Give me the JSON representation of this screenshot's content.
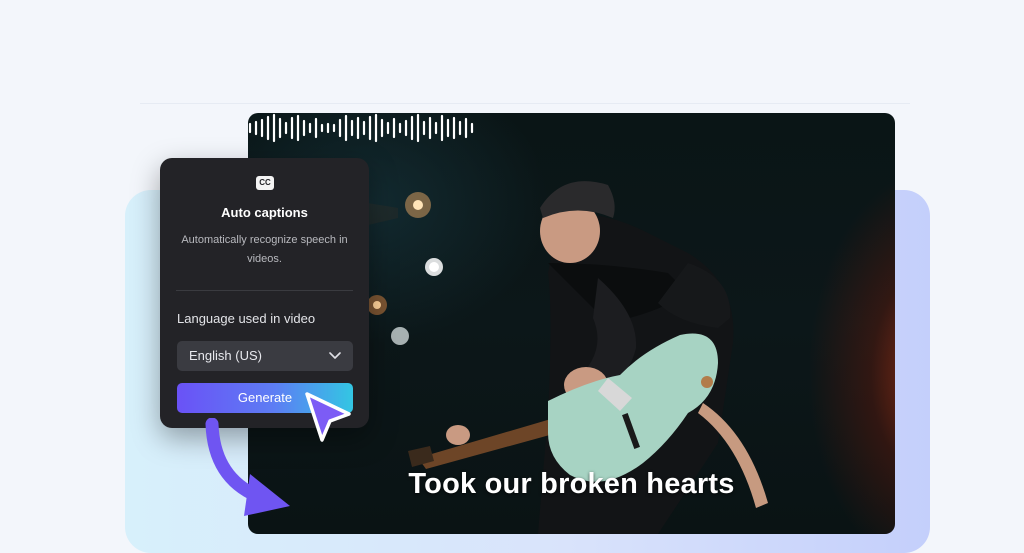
{
  "panel": {
    "icon": "closed-captions-icon",
    "icon_text": "CC",
    "title": "Auto captions",
    "description": "Automatically recognize speech in videos.",
    "language_label": "Language used in video",
    "language_value": "English (US)",
    "generate_label": "Generate"
  },
  "video": {
    "caption": "Took our broken hearts"
  },
  "colors": {
    "panel_bg": "#232327",
    "button_start": "#6a52f6",
    "button_end": "#33c6e3",
    "cursor": "#7c5cf5",
    "arrow": "#6f55f2"
  }
}
